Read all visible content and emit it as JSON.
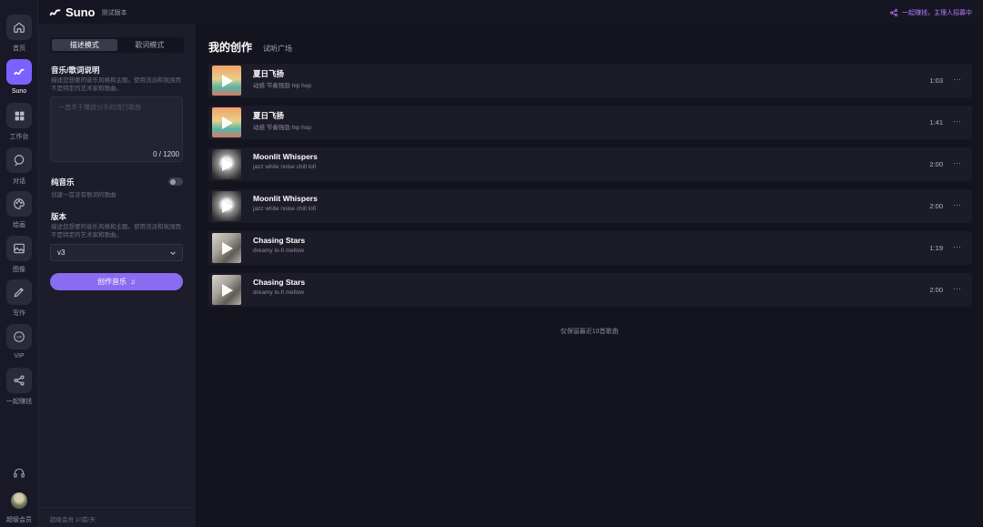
{
  "rail": {
    "items": [
      {
        "label": "首页",
        "icon": "home-icon"
      },
      {
        "label": "Suno",
        "icon": "suno-icon"
      },
      {
        "label": "工作台",
        "icon": "grid-icon"
      },
      {
        "label": "对话",
        "icon": "chat-icon"
      },
      {
        "label": "绘画",
        "icon": "palette-icon"
      },
      {
        "label": "图像",
        "icon": "image-icon"
      },
      {
        "label": "写作",
        "icon": "pen-icon"
      },
      {
        "label": "VIP",
        "icon": "vip-icon"
      },
      {
        "label": "一起赚钱",
        "icon": "share-icon"
      }
    ],
    "user_label": "超级会员"
  },
  "header": {
    "app_name": "Suno",
    "app_tag": "测试版本",
    "invite_text": "一起赚钱，主理人招募中"
  },
  "composer": {
    "mode_tabs": [
      "描述模式",
      "歌词模式"
    ],
    "active_mode": 0,
    "description_title": "音乐/歌词说明",
    "description_hint": "描述您想要的音乐风格和主题。使用流派和氛围而不是特定的艺术家和歌曲。",
    "prompt_placeholder": "一首关于播放分手的流行歌曲",
    "prompt_count": "0 / 1200",
    "instrumental_title": "纯音乐",
    "instrumental_hint": "创建一首没有歌词的歌曲",
    "instrumental_on": false,
    "version_title": "版本",
    "version_hint": "描述您想要的音乐风格和主题。使用流派和氛围而不是特定的艺术家和歌曲。",
    "version_value": "v3",
    "create_label": "创作音乐",
    "footer_text": "超级会员 10首/天"
  },
  "main": {
    "tab_active": "我的创作",
    "tab_other": "试听广场",
    "songs": [
      {
        "title": "夏日飞扬",
        "tags": "动感 节奏强劲 hip hop",
        "duration": "1:03",
        "cover": "summer"
      },
      {
        "title": "夏日飞扬",
        "tags": "动感 节奏强劲 hip hop",
        "duration": "1:41",
        "cover": "summer"
      },
      {
        "title": "Moonlit Whispers",
        "tags": "jazz white noise chill lofi",
        "duration": "2:00",
        "cover": "moon"
      },
      {
        "title": "Moonlit Whispers",
        "tags": "jazz white noise chill lofi",
        "duration": "2:00",
        "cover": "moon"
      },
      {
        "title": "Chasing Stars",
        "tags": "dreamy lo-fi mellow",
        "duration": "1:19",
        "cover": "star"
      },
      {
        "title": "Chasing Stars",
        "tags": "dreamy lo-fi mellow",
        "duration": "2:00",
        "cover": "star"
      }
    ],
    "more_glyph": "···",
    "list_note": "仅保留最近10首歌曲"
  },
  "colors": {
    "accent": "#7b61ff",
    "button": "#8a6cf0",
    "invite": "#b77dff"
  }
}
